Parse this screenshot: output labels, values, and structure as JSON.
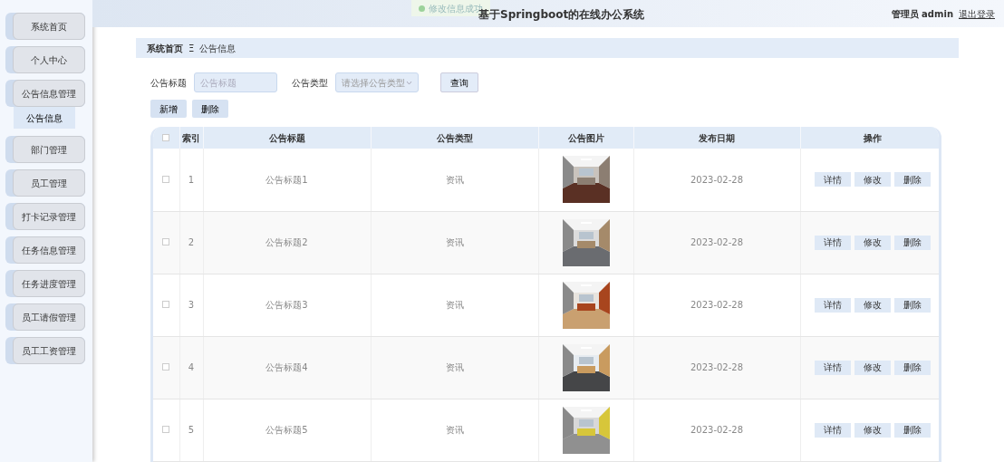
{
  "header": {
    "title": "基于Springboot的在线办公系统",
    "user_role": "管理员",
    "user_name": "admin",
    "logout": "退出登录"
  },
  "toast": {
    "text": "修改信息成功"
  },
  "sidebar": {
    "items": [
      {
        "label": "系统首页"
      },
      {
        "label": "个人中心"
      },
      {
        "label": "公告信息管理",
        "children": [
          {
            "label": "公告信息",
            "selected": true
          }
        ]
      },
      {
        "label": "部门管理"
      },
      {
        "label": "员工管理"
      },
      {
        "label": "打卡记录管理"
      },
      {
        "label": "任务信息管理"
      },
      {
        "label": "任务进度管理"
      },
      {
        "label": "员工请假管理"
      },
      {
        "label": "员工工资管理"
      }
    ]
  },
  "breadcrumb": {
    "items": [
      "系统首页",
      "公告信息"
    ],
    "separator": "Ξ"
  },
  "search": {
    "fields": [
      {
        "label": "公告标题",
        "kind": "text",
        "placeholder": "公告标题"
      },
      {
        "label": "公告类型",
        "kind": "select",
        "placeholder": "请选择公告类型"
      }
    ],
    "button": "查询"
  },
  "actions": [
    "新增",
    "删除"
  ],
  "table": {
    "all_checked": false,
    "columns": [
      "索引",
      "公告标题",
      "公告类型",
      "公告图片",
      "发布日期",
      "操作"
    ],
    "rows": [
      {
        "checked": false,
        "index": "1",
        "title": "公告标题1",
        "type": "资讯",
        "date": "2023-02-28",
        "buttons": [
          "详情",
          "修改",
          "删除"
        ]
      },
      {
        "checked": false,
        "index": "2",
        "title": "公告标题2",
        "type": "资讯",
        "date": "2023-02-28",
        "buttons": [
          "详情",
          "修改",
          "删除"
        ]
      },
      {
        "checked": false,
        "index": "3",
        "title": "公告标题3",
        "type": "资讯",
        "date": "2023-02-28",
        "buttons": [
          "详情",
          "修改",
          "删除"
        ]
      },
      {
        "checked": false,
        "index": "4",
        "title": "公告标题4",
        "type": "资讯",
        "date": "2023-02-28",
        "buttons": [
          "详情",
          "修改",
          "删除"
        ]
      },
      {
        "checked": false,
        "index": "5",
        "title": "公告标题5",
        "type": "资讯",
        "date": "2023-02-28",
        "buttons": [
          "详情",
          "修改",
          "删除"
        ]
      }
    ]
  }
}
